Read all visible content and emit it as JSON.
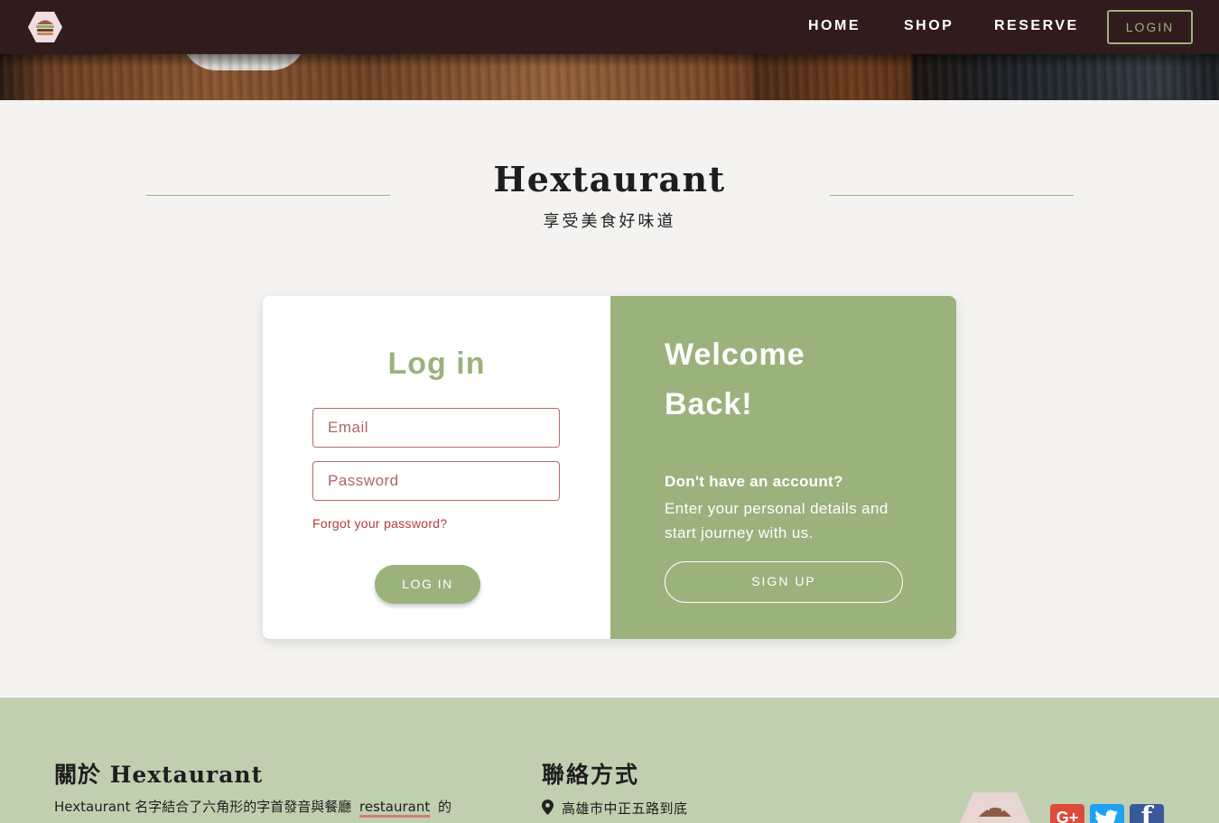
{
  "nav": {
    "logo_icon": "burger-hexagon-icon",
    "links": [
      "HOME",
      "SHOP",
      "RESERVE"
    ],
    "login_label": "LOGIN"
  },
  "brand": {
    "title": "Hextaurant",
    "subtitle": "享受美食好味道"
  },
  "login_form": {
    "heading": "Log in",
    "email_placeholder": "Email",
    "password_placeholder": "Password",
    "forgot_label": "Forgot your password?",
    "submit_label": "LOG IN"
  },
  "welcome_panel": {
    "title": "Welcome Back!",
    "no_account": "Don't have an account?",
    "text": "Enter your personal details and start journey with us.",
    "signup_label": "SIGN UP"
  },
  "footer": {
    "about": {
      "heading": "關於 Hextaurant",
      "text_lead": "Hextaurant",
      "text_mid": " 名字結合了六角形的字首發音與餐廳 ",
      "text_highlight": "restaurant",
      "text_end": " 的"
    },
    "contact": {
      "heading": "聯絡方式",
      "address_icon": "map-pin-icon",
      "address": "高雄市中正五路到底"
    },
    "social": {
      "gplus_label": "G+",
      "twitter_icon": "twitter-icon",
      "facebook_label": "f"
    }
  },
  "colors": {
    "nav_bg": "#301c1c",
    "accent_green": "#9bb27d",
    "field_border": "#b96a6a",
    "forgot_link": "#b03a3a",
    "page_bg": "#f4f3f1",
    "footer_bg": "#c0cfb0"
  }
}
